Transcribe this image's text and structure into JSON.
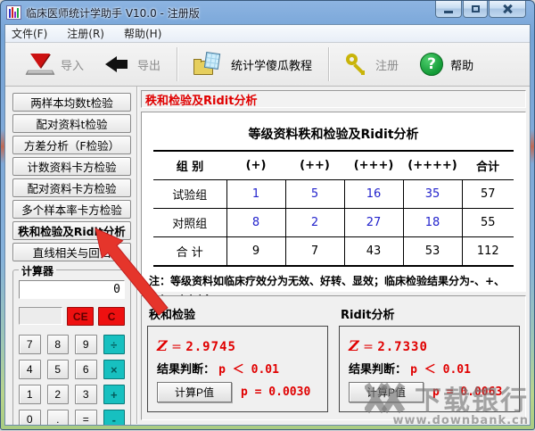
{
  "window": {
    "title": "临床医师统计学助手 V10.0 - 注册版",
    "controls": [
      "minimize-icon",
      "maximize-icon",
      "close-icon"
    ]
  },
  "menu": {
    "items": [
      "文件(F)",
      "注册(R)",
      "帮助(H)"
    ]
  },
  "toolbar": {
    "import_label": "导入",
    "export_label": "导出",
    "tutorial_label": "统计学傻瓜教程",
    "register_label": "注册",
    "help_label": "帮助",
    "help_glyph": "?"
  },
  "sidebar": {
    "items": [
      "两样本均数t检验",
      "配对资料t检验",
      "方差分析（F检验）",
      "计数资料卡方检验",
      "配对资料卡方检验",
      "多个样本率卡方检验",
      "秩和检验及Ridit分析",
      "直线相关与回归"
    ],
    "active_index": 6
  },
  "calculator": {
    "title": "计算器",
    "display_value": "0",
    "clear_entry_label": "CE",
    "clear_label": "C",
    "keys": [
      [
        "7",
        "8",
        "9",
        "÷"
      ],
      [
        "4",
        "5",
        "6",
        "×"
      ],
      [
        "1",
        "2",
        "3",
        "+"
      ],
      [
        "0",
        ".",
        "=",
        "-"
      ]
    ]
  },
  "main": {
    "header": "秩和检验及Ridit分析",
    "table": {
      "title": "等级资料秩和检验及Ridit分析",
      "columns": [
        "组  别",
        "(+)",
        "(++)",
        "(+++)",
        "(++++)",
        "合计"
      ],
      "rows": [
        {
          "label": "试验组",
          "values": [
            "1",
            "5",
            "16",
            "35"
          ],
          "total": "57"
        },
        {
          "label": "对照组",
          "values": [
            "8",
            "2",
            "27",
            "18"
          ],
          "total": "55"
        },
        {
          "label": "合  计",
          "values": [
            "9",
            "7",
            "43",
            "53"
          ],
          "total": "112"
        }
      ],
      "note_line1": "注：等级资料如临床疗效分为无效、好转、显效；临床检验结果分为-、+、++、+++；",
      "note_line2": "疼痛等症状的严重程度分为无疼痛、轻度、中度、重度等。"
    },
    "rank_test": {
      "title": "秩和检验",
      "z_symbol": "Z",
      "equals": "=",
      "z_value": "2.9745",
      "judge_label": "结果判断：",
      "judge_value": "p ＜ 0.01",
      "button_label": "计算P值",
      "p_text": "p = 0.0030"
    },
    "ridit": {
      "title": "Ridit分析",
      "z_symbol": "Z",
      "equals": "=",
      "z_value": "2.7330",
      "judge_label": "结果判断：",
      "judge_value": "p ＜ 0.01",
      "button_label": "计算P值",
      "p_text": "p = 0.0063"
    }
  },
  "watermark": {
    "name": "下载银行",
    "url": "www.downbank.cn"
  },
  "colors": {
    "accent_red": "#e00000",
    "data_blue": "#2323cc",
    "calc_danger": "#ee1010",
    "calc_op_teal": "#17c0c0",
    "arrow_red": "#e5352b"
  }
}
